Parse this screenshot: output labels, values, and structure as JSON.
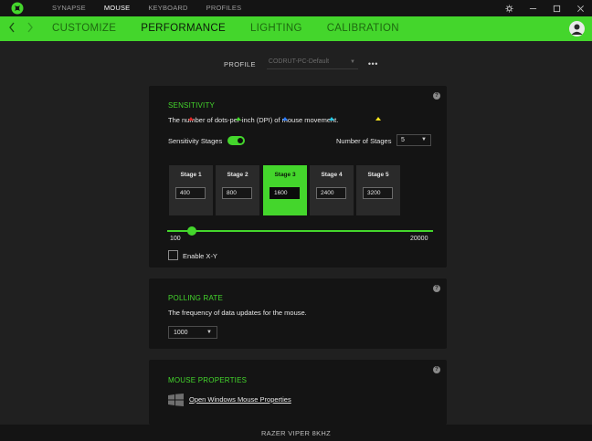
{
  "topnav": {
    "items": [
      "SYNAPSE",
      "MOUSE",
      "KEYBOARD",
      "PROFILES"
    ],
    "active": "MOUSE"
  },
  "window": {
    "settings_icon": "gear-icon",
    "minimize_icon": "minimize-icon",
    "maximize_icon": "maximize-icon",
    "close_icon": "close-icon"
  },
  "subnav": {
    "tabs": [
      "CUSTOMIZE",
      "PERFORMANCE",
      "LIGHTING",
      "CALIBRATION"
    ],
    "active": "PERFORMANCE",
    "accent": "#44d62c"
  },
  "profile": {
    "label": "PROFILE",
    "value": "CODRUT-PC-Default",
    "more": "•••"
  },
  "sensitivity": {
    "title": "SENSITIVITY",
    "description": "The number of dots-per-inch (DPI) of mouse movement.",
    "stages_label": "Sensitivity Stages",
    "stages_enabled": true,
    "num_stages_label": "Number of Stages",
    "num_stages": "5",
    "stages": [
      {
        "label": "Stage 1",
        "value": "400",
        "color": "#e02525"
      },
      {
        "label": "Stage 2",
        "value": "800",
        "color": "#44d62c"
      },
      {
        "label": "Stage 3",
        "value": "1600",
        "color": "#2a7bff"
      },
      {
        "label": "Stage 4",
        "value": "2400",
        "color": "#22c9e6"
      },
      {
        "label": "Stage 5",
        "value": "3200",
        "color": "#f4e21c"
      }
    ],
    "active_stage": 3,
    "slider_min": "100",
    "slider_max": "20000",
    "slider_value": 1600,
    "enable_xy_label": "Enable X-Y",
    "enable_xy": false
  },
  "polling": {
    "title": "POLLING RATE",
    "description": "The frequency of data updates for the mouse.",
    "value": "1000"
  },
  "mouse_properties": {
    "title": "MOUSE PROPERTIES",
    "link": "Open Windows Mouse Properties"
  },
  "statusbar": {
    "device": "RAZER VIPER 8KHZ"
  }
}
